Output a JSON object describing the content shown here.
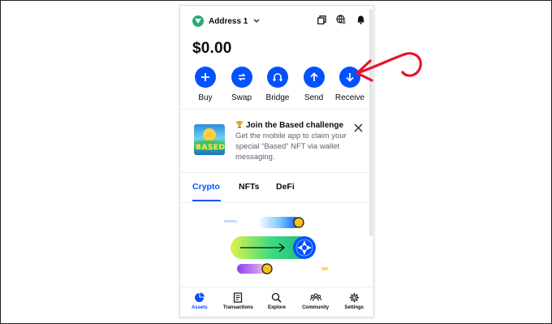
{
  "header": {
    "account_name": "Address 1",
    "icons": [
      "account-avatar-icon",
      "chevron-down-icon",
      "copy-icon",
      "network-globe-icon",
      "bell-icon"
    ]
  },
  "balance": "$0.00",
  "actions": [
    {
      "label": "Buy",
      "icon": "plus-icon"
    },
    {
      "label": "Swap",
      "icon": "swap-icon"
    },
    {
      "label": "Bridge",
      "icon": "bridge-icon"
    },
    {
      "label": "Send",
      "icon": "arrow-up-icon"
    },
    {
      "label": "Receive",
      "icon": "arrow-down-icon"
    }
  ],
  "promo": {
    "title": "Join the Based challenge",
    "body": "Get the mobile app to claim your special “Based” NFT via wallet messaging.",
    "image_text": "BASED",
    "icons": [
      "trophy-icon",
      "close-icon"
    ]
  },
  "tabs": [
    {
      "label": "Crypto",
      "active": true
    },
    {
      "label": "NFTs",
      "active": false
    },
    {
      "label": "DeFi",
      "active": false
    }
  ],
  "bottom_nav": [
    {
      "label": "Assets",
      "icon": "pie-chart-icon",
      "active": true
    },
    {
      "label": "Transactions",
      "icon": "receipt-icon",
      "active": false
    },
    {
      "label": "Explore",
      "icon": "search-icon",
      "active": false
    },
    {
      "label": "Community",
      "icon": "people-icon",
      "active": false
    },
    {
      "label": "Settings",
      "icon": "gear-icon",
      "active": false
    }
  ],
  "colors": {
    "accent": "#0052ff",
    "annotation": "#e8132b",
    "text": "#0a0b0d",
    "muted": "#5b616e"
  }
}
